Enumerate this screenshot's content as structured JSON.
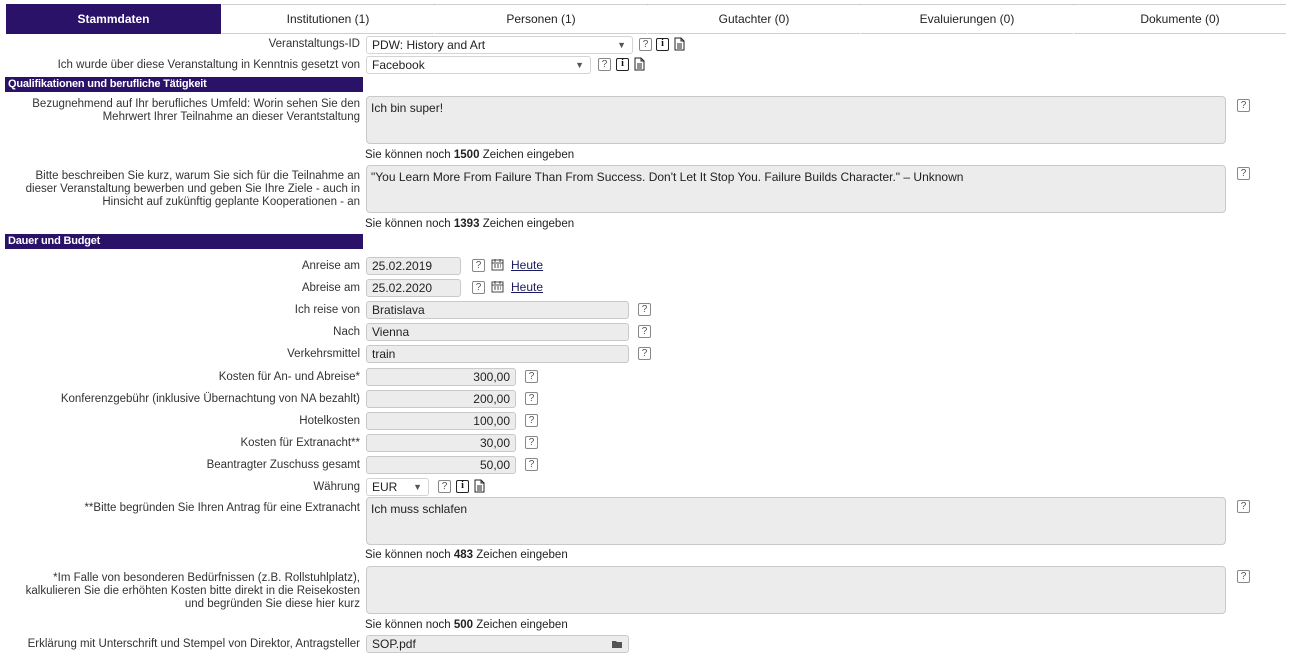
{
  "tabs": [
    {
      "label": "Stammdaten"
    },
    {
      "label": "Institutionen (1)"
    },
    {
      "label": "Personen (1)"
    },
    {
      "label": "Gutachter (0)"
    },
    {
      "label": "Evaluierungen (0)"
    },
    {
      "label": "Dokumente (0)"
    }
  ],
  "fields": {
    "event_id": {
      "label": "Veranstaltungs-ID",
      "value": "PDW: History and Art"
    },
    "source": {
      "label": "Ich wurde über diese Veranstaltung in Kenntnis gesetzt von",
      "value": "Facebook"
    },
    "qual_section": "Qualifikationen und berufliche Tätigkeit",
    "added_value": {
      "label": "Bezugnehmend auf Ihr berufliches Umfeld: Worin sehen Sie den Mehrwert Ihrer Teilnahme an dieser Verantstaltung",
      "value": "Ich bin super!",
      "hint_pre": "Sie können noch",
      "hint_num": "1500",
      "hint_post": "Zeichen eingeben"
    },
    "goals": {
      "label": "Bitte beschreiben Sie kurz, warum Sie sich für die Teilnahme an dieser Veranstaltung bewerben und geben Sie Ihre Ziele - auch in Hinsicht auf zukünftig geplante Kooperationen - an",
      "value": "\"You Learn More From Failure Than From Success. Don't Let It Stop You. Failure Builds Character.\" – Unknown",
      "hint_pre": "Sie können noch",
      "hint_num": "1393",
      "hint_post": "Zeichen eingeben"
    },
    "budget_section": "Dauer und Budget",
    "arrival": {
      "label": "Anreise am",
      "value": "25.02.2019",
      "link": "Heute"
    },
    "departure": {
      "label": "Abreise am",
      "value": "25.02.2020",
      "link": "Heute"
    },
    "from": {
      "label": "Ich reise von",
      "value": "Bratislava"
    },
    "to": {
      "label": "Nach",
      "value": "Vienna"
    },
    "transport": {
      "label": "Verkehrsmittel",
      "value": "train"
    },
    "travel_cost": {
      "label": "Kosten für An- und Abreise*",
      "value": "300,00"
    },
    "conf_fee": {
      "label": "Konferenzgebühr (inklusive Übernachtung von NA bezahlt)",
      "value": "200,00"
    },
    "hotel": {
      "label": "Hotelkosten",
      "value": "100,00"
    },
    "extra_night": {
      "label": "Kosten für Extranacht**",
      "value": "30,00"
    },
    "total": {
      "label": "Beantragter Zuschuss gesamt",
      "value": "50,00"
    },
    "currency": {
      "label": "Währung",
      "value": "EUR"
    },
    "extra_reason": {
      "label": "**Bitte begründen Sie Ihren Antrag für eine Extranacht",
      "value": "Ich muss schlafen",
      "hint_pre": "Sie können noch",
      "hint_num": "483",
      "hint_post": "Zeichen eingeben"
    },
    "special_needs": {
      "label": "*Im Falle von besonderen Bedürfnissen (z.B. Rollstuhlplatz), kalkulieren Sie die erhöhten Kosten bitte direkt in die Reisekosten und begründen Sie diese hier kurz",
      "value": "",
      "hint_pre": "Sie können noch",
      "hint_num": "500",
      "hint_post": "Zeichen eingeben"
    },
    "declaration": {
      "label": "Erklärung mit Unterschrift und Stempel von Direktor, Antragsteller",
      "value": "SOP.pdf"
    }
  },
  "icons": {
    "help": "?",
    "info": "i"
  },
  "colors": {
    "accent": "#2a1268",
    "field_bg": "#ececec"
  }
}
